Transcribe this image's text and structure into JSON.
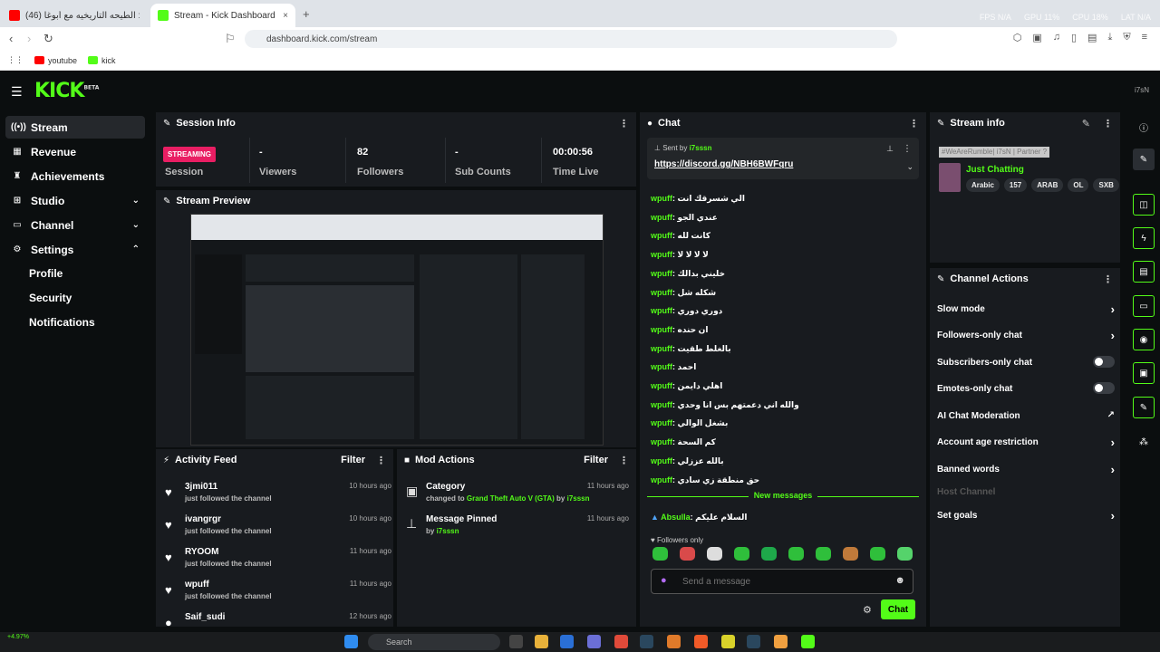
{
  "browser": {
    "tabs": [
      {
        "title": "(46) قرائد 5 : الطيحه التاريخيه مع أبوغا...",
        "active": false,
        "favicon_color": "#ff0000"
      },
      {
        "title": "Stream - Kick Dashboard",
        "active": true,
        "favicon_color": "#53fc18"
      }
    ],
    "new_tab": "+",
    "close": "×",
    "perf": [
      "FPS N/A",
      "GPU 11%",
      "CPU 18%",
      "LAT N/A"
    ],
    "url": "dashboard.kick.com/stream",
    "bookmarks": [
      {
        "label": "youtube",
        "color": "#ff0000"
      },
      {
        "label": "kick",
        "color": "#53fc18"
      }
    ]
  },
  "kick": {
    "logo": "KICK",
    "logo_badge": "BETA",
    "user_tag": "i7sN"
  },
  "sidebar": {
    "items": [
      {
        "label": "Stream",
        "icon": "stream-icon",
        "glyph": "((•))",
        "active": true
      },
      {
        "label": "Revenue",
        "icon": "revenue-icon",
        "glyph": "▦"
      },
      {
        "label": "Achievements",
        "icon": "trophy-icon",
        "glyph": "♜"
      },
      {
        "label": "Studio",
        "icon": "studio-icon",
        "glyph": "⊞",
        "chevron": "⌄"
      },
      {
        "label": "Channel",
        "icon": "channel-icon",
        "glyph": "▭",
        "chevron": "⌄"
      },
      {
        "label": "Settings",
        "icon": "gear-icon",
        "glyph": "⚙",
        "chevron": "⌃"
      }
    ],
    "sub_items": [
      "Profile",
      "Security",
      "Notifications"
    ]
  },
  "session": {
    "title": "Session Info",
    "status_badge": "STREAMING",
    "status_label": "Session",
    "stats": [
      {
        "value": "-",
        "label": "Viewers"
      },
      {
        "value": "82",
        "label": "Followers"
      },
      {
        "value": "-",
        "label": "Sub Counts"
      },
      {
        "value": "00:00:56",
        "label": "Time Live"
      }
    ]
  },
  "preview": {
    "title": "Stream Preview"
  },
  "activity": {
    "title": "Activity Feed",
    "filter": "Filter",
    "items": [
      {
        "name": "3jmi011",
        "desc": "just followed the channel",
        "time": "10 hours ago"
      },
      {
        "name": "ivangrgr",
        "desc": "just followed the channel",
        "time": "10 hours ago"
      },
      {
        "name": "RYOOM",
        "desc": "just followed the channel",
        "time": "11 hours ago"
      },
      {
        "name": "wpuff",
        "desc": "just followed the channel",
        "time": "11 hours ago"
      },
      {
        "name": "Saif_sudi",
        "desc": "",
        "time": "12 hours ago"
      }
    ]
  },
  "mod": {
    "title": "Mod Actions",
    "filter": "Filter",
    "items": [
      {
        "title": "Category",
        "prefix": "changed to",
        "highlight": "Grand Theft Auto V (GTA)",
        "by": "by",
        "user": "i7sssn",
        "time": "11 hours ago",
        "icon": "category-icon"
      },
      {
        "title": "Message Pinned",
        "prefix": "",
        "highlight": "",
        "by": "by",
        "user": "i7sssn",
        "time": "11 hours ago",
        "icon": "pin-icon"
      }
    ]
  },
  "chat": {
    "title": "Chat",
    "pinned_sent_by": "Sent by",
    "pinned_user": "i7sssn",
    "pinned_link": "https://discord.gg/NBH6BWFqru",
    "messages": [
      {
        "user": "wpuff",
        "text": "الي شسرقك انت"
      },
      {
        "user": "wpuff",
        "text": "عندي الجو"
      },
      {
        "user": "wpuff",
        "text": "كانت لله"
      },
      {
        "user": "wpuff",
        "text": "لا لا لا لا"
      },
      {
        "user": "wpuff",
        "text": "خليني بدالك"
      },
      {
        "user": "wpuff",
        "text": "شكله شل"
      },
      {
        "user": "wpuff",
        "text": "دوري دوري"
      },
      {
        "user": "wpuff",
        "text": "ان حنده"
      },
      {
        "user": "wpuff",
        "text": "بالغلط طقيت"
      },
      {
        "user": "wpuff",
        "text": "احمد"
      },
      {
        "user": "wpuff",
        "text": "اهلي دايمن"
      },
      {
        "user": "wpuff",
        "text": "والله اني دعمتهم بس انا وحدي"
      },
      {
        "user": "wpuff",
        "text": "بشغل الوالي"
      },
      {
        "user": "wpuff",
        "text": "كم السحة"
      },
      {
        "user": "wpuff",
        "text": "بالله عززلي"
      },
      {
        "user": "wpuff",
        "text": "حق منطقة زي سادي"
      }
    ],
    "new_messages": "New messages",
    "new_message": {
      "user": "Absulla",
      "text": "السلام عليكم"
    },
    "followers_only": "Followers only",
    "placeholder": "Send a message",
    "send": "Chat"
  },
  "stream_info": {
    "title": "Stream info",
    "tags_line": "#WeAreRumble| i7sN | Partner ?",
    "category": "Just Chatting",
    "tags": [
      "Arabic",
      "157",
      "ARAB",
      "OL",
      "SXB"
    ]
  },
  "channel_actions": {
    "title": "Channel Actions",
    "items": [
      {
        "label": "Slow mode",
        "kind": "arrow"
      },
      {
        "label": "Followers-only chat",
        "kind": "arrow"
      },
      {
        "label": "Subscribers-only chat",
        "kind": "toggle"
      },
      {
        "label": "Emotes-only chat",
        "kind": "toggle"
      },
      {
        "label": "AI Chat Moderation",
        "kind": "external"
      },
      {
        "label": "Account age restriction",
        "kind": "arrow"
      },
      {
        "label": "Banned words",
        "kind": "arrow"
      },
      {
        "label": "Host Channel",
        "kind": "disabled"
      },
      {
        "label": "Set goals",
        "kind": "arrow"
      }
    ]
  },
  "taskbar": {
    "search": "Search",
    "stock": "+4.97%"
  },
  "colors": {
    "accent": "#53fc18",
    "live": "#e91e63",
    "panel": "#181b1f"
  }
}
